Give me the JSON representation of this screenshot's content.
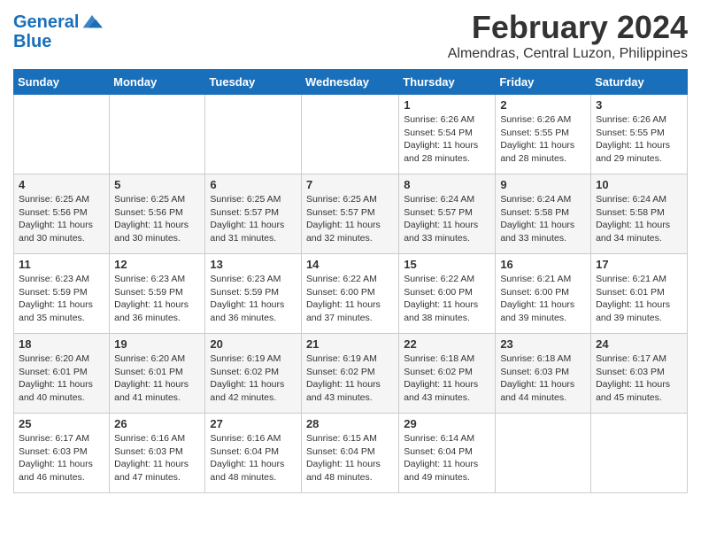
{
  "header": {
    "logo_line1": "General",
    "logo_line2": "Blue",
    "month": "February 2024",
    "location": "Almendras, Central Luzon, Philippines"
  },
  "weekdays": [
    "Sunday",
    "Monday",
    "Tuesday",
    "Wednesday",
    "Thursday",
    "Friday",
    "Saturday"
  ],
  "weeks": [
    [
      {
        "day": "",
        "info": ""
      },
      {
        "day": "",
        "info": ""
      },
      {
        "day": "",
        "info": ""
      },
      {
        "day": "",
        "info": ""
      },
      {
        "day": "1",
        "info": "Sunrise: 6:26 AM\nSunset: 5:54 PM\nDaylight: 11 hours and 28 minutes."
      },
      {
        "day": "2",
        "info": "Sunrise: 6:26 AM\nSunset: 5:55 PM\nDaylight: 11 hours and 28 minutes."
      },
      {
        "day": "3",
        "info": "Sunrise: 6:26 AM\nSunset: 5:55 PM\nDaylight: 11 hours and 29 minutes."
      }
    ],
    [
      {
        "day": "4",
        "info": "Sunrise: 6:25 AM\nSunset: 5:56 PM\nDaylight: 11 hours and 30 minutes."
      },
      {
        "day": "5",
        "info": "Sunrise: 6:25 AM\nSunset: 5:56 PM\nDaylight: 11 hours and 30 minutes."
      },
      {
        "day": "6",
        "info": "Sunrise: 6:25 AM\nSunset: 5:57 PM\nDaylight: 11 hours and 31 minutes."
      },
      {
        "day": "7",
        "info": "Sunrise: 6:25 AM\nSunset: 5:57 PM\nDaylight: 11 hours and 32 minutes."
      },
      {
        "day": "8",
        "info": "Sunrise: 6:24 AM\nSunset: 5:57 PM\nDaylight: 11 hours and 33 minutes."
      },
      {
        "day": "9",
        "info": "Sunrise: 6:24 AM\nSunset: 5:58 PM\nDaylight: 11 hours and 33 minutes."
      },
      {
        "day": "10",
        "info": "Sunrise: 6:24 AM\nSunset: 5:58 PM\nDaylight: 11 hours and 34 minutes."
      }
    ],
    [
      {
        "day": "11",
        "info": "Sunrise: 6:23 AM\nSunset: 5:59 PM\nDaylight: 11 hours and 35 minutes."
      },
      {
        "day": "12",
        "info": "Sunrise: 6:23 AM\nSunset: 5:59 PM\nDaylight: 11 hours and 36 minutes."
      },
      {
        "day": "13",
        "info": "Sunrise: 6:23 AM\nSunset: 5:59 PM\nDaylight: 11 hours and 36 minutes."
      },
      {
        "day": "14",
        "info": "Sunrise: 6:22 AM\nSunset: 6:00 PM\nDaylight: 11 hours and 37 minutes."
      },
      {
        "day": "15",
        "info": "Sunrise: 6:22 AM\nSunset: 6:00 PM\nDaylight: 11 hours and 38 minutes."
      },
      {
        "day": "16",
        "info": "Sunrise: 6:21 AM\nSunset: 6:00 PM\nDaylight: 11 hours and 39 minutes."
      },
      {
        "day": "17",
        "info": "Sunrise: 6:21 AM\nSunset: 6:01 PM\nDaylight: 11 hours and 39 minutes."
      }
    ],
    [
      {
        "day": "18",
        "info": "Sunrise: 6:20 AM\nSunset: 6:01 PM\nDaylight: 11 hours and 40 minutes."
      },
      {
        "day": "19",
        "info": "Sunrise: 6:20 AM\nSunset: 6:01 PM\nDaylight: 11 hours and 41 minutes."
      },
      {
        "day": "20",
        "info": "Sunrise: 6:19 AM\nSunset: 6:02 PM\nDaylight: 11 hours and 42 minutes."
      },
      {
        "day": "21",
        "info": "Sunrise: 6:19 AM\nSunset: 6:02 PM\nDaylight: 11 hours and 43 minutes."
      },
      {
        "day": "22",
        "info": "Sunrise: 6:18 AM\nSunset: 6:02 PM\nDaylight: 11 hours and 43 minutes."
      },
      {
        "day": "23",
        "info": "Sunrise: 6:18 AM\nSunset: 6:03 PM\nDaylight: 11 hours and 44 minutes."
      },
      {
        "day": "24",
        "info": "Sunrise: 6:17 AM\nSunset: 6:03 PM\nDaylight: 11 hours and 45 minutes."
      }
    ],
    [
      {
        "day": "25",
        "info": "Sunrise: 6:17 AM\nSunset: 6:03 PM\nDaylight: 11 hours and 46 minutes."
      },
      {
        "day": "26",
        "info": "Sunrise: 6:16 AM\nSunset: 6:03 PM\nDaylight: 11 hours and 47 minutes."
      },
      {
        "day": "27",
        "info": "Sunrise: 6:16 AM\nSunset: 6:04 PM\nDaylight: 11 hours and 48 minutes."
      },
      {
        "day": "28",
        "info": "Sunrise: 6:15 AM\nSunset: 6:04 PM\nDaylight: 11 hours and 48 minutes."
      },
      {
        "day": "29",
        "info": "Sunrise: 6:14 AM\nSunset: 6:04 PM\nDaylight: 11 hours and 49 minutes."
      },
      {
        "day": "",
        "info": ""
      },
      {
        "day": "",
        "info": ""
      }
    ]
  ]
}
